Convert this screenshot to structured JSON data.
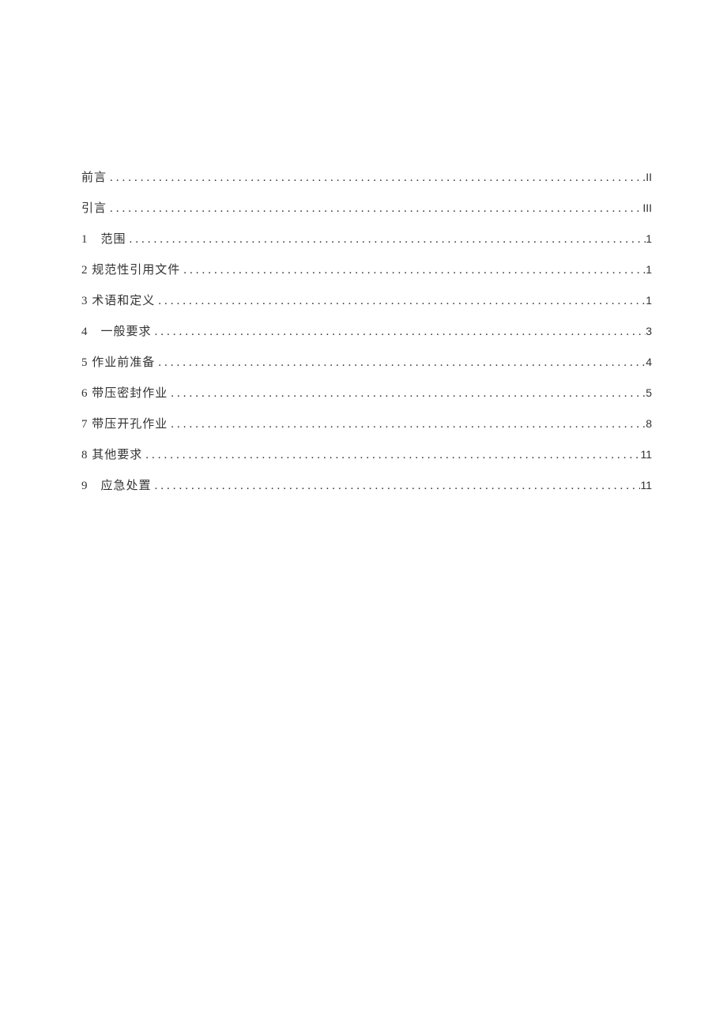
{
  "toc": [
    {
      "label": "前言",
      "page": "II"
    },
    {
      "label": "引言",
      "page": "III"
    },
    {
      "label": "1　范围",
      "page": "1"
    },
    {
      "label": "2 规范性引用文件",
      "page": "1"
    },
    {
      "label": "3 术语和定义",
      "page": "1"
    },
    {
      "label": "4　一般要求",
      "page": "3"
    },
    {
      "label": "5 作业前准备",
      "page": "4"
    },
    {
      "label": "6 带压密封作业",
      "page": "5"
    },
    {
      "label": "7 带压开孔作业",
      "page": "8"
    },
    {
      "label": "8 其他要求",
      "page": "11"
    },
    {
      "label": "9　应急处置",
      "page": "11"
    }
  ]
}
